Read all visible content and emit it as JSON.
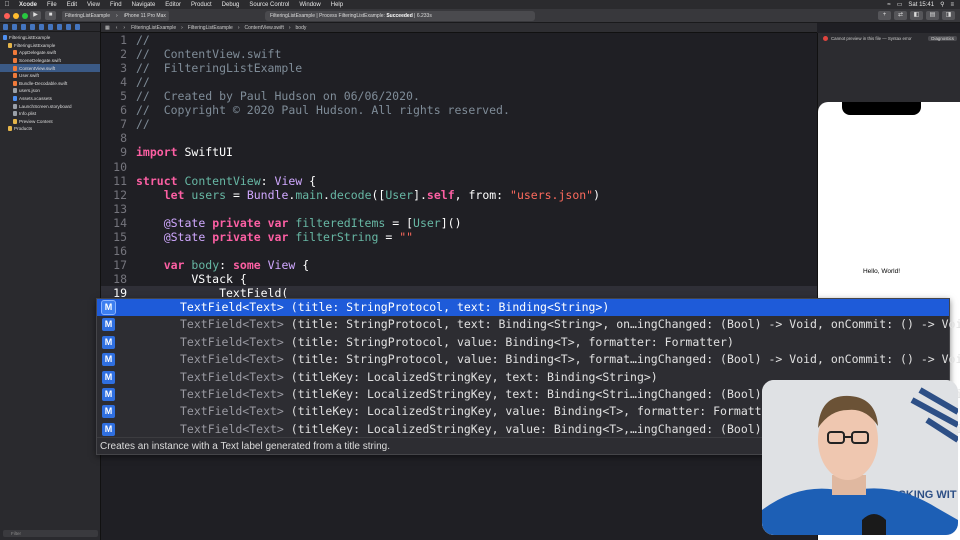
{
  "menubar": {
    "app": "Xcode",
    "items": [
      "File",
      "Edit",
      "View",
      "Find",
      "Navigate",
      "Editor",
      "Product",
      "Debug",
      "Source Control",
      "Window",
      "Help"
    ],
    "clock": "Sat 15:41"
  },
  "toolbar": {
    "scheme": "FilteringListExample",
    "device": "iPhone 11 Pro Max",
    "status_prefix": "FilteringListExample | Process FilteringListExample:",
    "status_result": "Succeeded",
    "status_time": "| 6.233s"
  },
  "navigator": {
    "items": [
      {
        "label": "FilteringListExample",
        "level": 0,
        "kind": "project",
        "selected": false
      },
      {
        "label": "FilteringListExample",
        "level": 1,
        "kind": "folder",
        "selected": false
      },
      {
        "label": "AppDelegate.swift",
        "level": 2,
        "kind": "swift",
        "selected": false
      },
      {
        "label": "SceneDelegate.swift",
        "level": 2,
        "kind": "swift",
        "selected": false
      },
      {
        "label": "ContentView.swift",
        "level": 2,
        "kind": "swift",
        "selected": true
      },
      {
        "label": "User.swift",
        "level": 2,
        "kind": "swift",
        "selected": false
      },
      {
        "label": "Bundle-Decodable.swift",
        "level": 2,
        "kind": "swift",
        "selected": false
      },
      {
        "label": "users.json",
        "level": 2,
        "kind": "file",
        "selected": false
      },
      {
        "label": "Assets.xcassets",
        "level": 2,
        "kind": "assets",
        "selected": false
      },
      {
        "label": "LaunchScreen.storyboard",
        "level": 2,
        "kind": "file",
        "selected": false
      },
      {
        "label": "Info.plist",
        "level": 2,
        "kind": "file",
        "selected": false
      },
      {
        "label": "Preview Content",
        "level": 2,
        "kind": "folder",
        "selected": false
      },
      {
        "label": "Products",
        "level": 1,
        "kind": "folder",
        "selected": false
      }
    ],
    "filter_placeholder": "Filter"
  },
  "jumpbar": {
    "crumbs": [
      "FilteringListExample",
      "FilteringListExample",
      "ContentView.swift",
      "body"
    ]
  },
  "editor": {
    "lines": [
      {
        "n": "1",
        "seg": [
          [
            "c-com",
            "//"
          ]
        ]
      },
      {
        "n": "2",
        "seg": [
          [
            "c-com",
            "//  ContentView.swift"
          ]
        ]
      },
      {
        "n": "3",
        "seg": [
          [
            "c-com",
            "//  FilteringListExample"
          ]
        ]
      },
      {
        "n": "4",
        "seg": [
          [
            "c-com",
            "//"
          ]
        ]
      },
      {
        "n": "5",
        "seg": [
          [
            "c-com",
            "//  Created by Paul Hudson on 06/06/2020."
          ]
        ]
      },
      {
        "n": "6",
        "seg": [
          [
            "c-com",
            "//  Copyright © 2020 Paul Hudson. All rights reserved."
          ]
        ]
      },
      {
        "n": "7",
        "seg": [
          [
            "c-com",
            "//"
          ]
        ]
      },
      {
        "n": "8",
        "seg": []
      },
      {
        "n": "9",
        "seg": [
          [
            "c-kw",
            "import"
          ],
          [
            "",
            " SwiftUI"
          ]
        ]
      },
      {
        "n": "10",
        "seg": []
      },
      {
        "n": "11",
        "seg": [
          [
            "c-kw",
            "struct"
          ],
          [
            "",
            " "
          ],
          [
            "c-ref",
            "ContentView"
          ],
          [
            "",
            ": "
          ],
          [
            "c-type",
            "View"
          ],
          [
            "",
            " {"
          ]
        ]
      },
      {
        "n": "12",
        "seg": [
          [
            "",
            "    "
          ],
          [
            "c-kw",
            "let"
          ],
          [
            "",
            " "
          ],
          [
            "c-ref",
            "users"
          ],
          [
            "",
            " = "
          ],
          [
            "c-type",
            "Bundle"
          ],
          [
            "",
            "."
          ],
          [
            "c-ref",
            "main"
          ],
          [
            "",
            "."
          ],
          [
            "c-ref",
            "decode"
          ],
          [
            "",
            "(["
          ],
          [
            "c-ref",
            "User"
          ],
          [
            "",
            "]."
          ],
          [
            "c-kw",
            "self"
          ],
          [
            "",
            ", from: "
          ],
          [
            "c-str",
            "\"users.json\""
          ],
          [
            "",
            ")"
          ]
        ]
      },
      {
        "n": "13",
        "seg": []
      },
      {
        "n": "14",
        "seg": [
          [
            "",
            "    "
          ],
          [
            "c-type",
            "@State"
          ],
          [
            "",
            " "
          ],
          [
            "c-kw",
            "private"
          ],
          [
            "",
            " "
          ],
          [
            "c-kw",
            "var"
          ],
          [
            "",
            " "
          ],
          [
            "c-ref",
            "filteredItems"
          ],
          [
            "",
            " = ["
          ],
          [
            "c-ref",
            "User"
          ],
          [
            "",
            "]()"
          ]
        ]
      },
      {
        "n": "15",
        "seg": [
          [
            "",
            "    "
          ],
          [
            "c-type",
            "@State"
          ],
          [
            "",
            " "
          ],
          [
            "c-kw",
            "private"
          ],
          [
            "",
            " "
          ],
          [
            "c-kw",
            "var"
          ],
          [
            "",
            " "
          ],
          [
            "c-ref",
            "filterString"
          ],
          [
            "",
            " = "
          ],
          [
            "c-str",
            "\"\""
          ]
        ]
      },
      {
        "n": "16",
        "seg": []
      },
      {
        "n": "17",
        "seg": [
          [
            "",
            "    "
          ],
          [
            "c-kw",
            "var"
          ],
          [
            "",
            " "
          ],
          [
            "c-ref",
            "body"
          ],
          [
            "",
            ": "
          ],
          [
            "c-kw",
            "some"
          ],
          [
            "",
            " "
          ],
          [
            "c-type",
            "View"
          ],
          [
            "",
            " {"
          ]
        ]
      },
      {
        "n": "18",
        "seg": [
          [
            "",
            "        VStack {"
          ]
        ]
      },
      {
        "n": "19",
        "seg": [
          [
            "",
            "            TextField("
          ]
        ],
        "current": true
      }
    ]
  },
  "autocomplete": {
    "badge": "M",
    "items": [
      {
        "ret": "TextField<Text>",
        "sig": " (title: StringProtocol, text: Binding<String>)",
        "selected": true
      },
      {
        "ret": "TextField<Text>",
        "sig": " (title: StringProtocol, text: Binding<String>, on…ingChanged: (Bool) -> Void, onCommit: () -> Void)",
        "selected": false
      },
      {
        "ret": "TextField<Text>",
        "sig": " (title: StringProtocol, value: Binding<T>, formatter: Formatter)",
        "selected": false
      },
      {
        "ret": "TextField<Text>",
        "sig": " (title: StringProtocol, value: Binding<T>, format…ingChanged: (Bool) -> Void, onCommit: () -> Void)",
        "selected": false
      },
      {
        "ret": "TextField<Text>",
        "sig": " (titleKey: LocalizedStringKey, text: Binding<String>)",
        "selected": false
      },
      {
        "ret": "TextField<Text>",
        "sig": " (titleKey: LocalizedStringKey, text: Binding<Stri…ingChanged: (Bool) -> Void, onCommit: () -> Void)",
        "selected": false
      },
      {
        "ret": "TextField<Text>",
        "sig": " (titleKey: LocalizedStringKey, value: Binding<T>, formatter: Formatter)",
        "selected": false
      },
      {
        "ret": "TextField<Text>",
        "sig": " (titleKey: LocalizedStringKey, value: Binding<T>,…ingChanged: (Bool) -> Void, onCommit: () -> Void)",
        "selected": false
      }
    ],
    "description": "Creates an instance with a Text label generated from a title string."
  },
  "canvas": {
    "error": "Cannot preview in this file — Syntax error",
    "diagnostics": "Diagnostics",
    "hello": "Hello, World!"
  },
  "webcam": {
    "background_text": "HACKING WIT"
  },
  "colors": {
    "accent": "#1e5bd9",
    "keyword": "#fc5fa3",
    "type": "#d0a8ff",
    "identifier": "#67b7a4",
    "string": "#fc6a5d",
    "comment": "#7f8c98"
  }
}
